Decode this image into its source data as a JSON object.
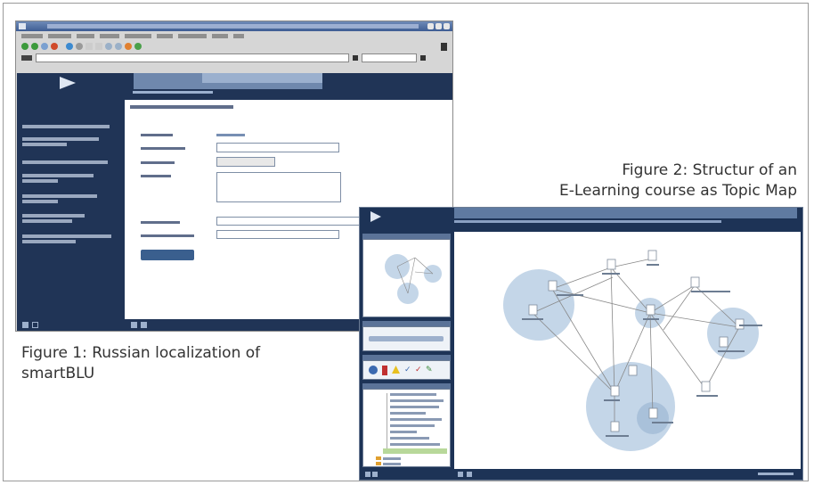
{
  "figure1": {
    "caption_line1": "Figure 1: Russian localization of",
    "caption_line2": "smartBLU"
  },
  "figure2": {
    "caption_line1": "Figure 2: Structur of an",
    "caption_line2": "E-Learning course as Topic Map"
  },
  "colors": {
    "app_navy": "#203456",
    "tab_blue": "#6f88ad",
    "node_bubble": "#c4d6e8",
    "caption_text": "#333333"
  }
}
